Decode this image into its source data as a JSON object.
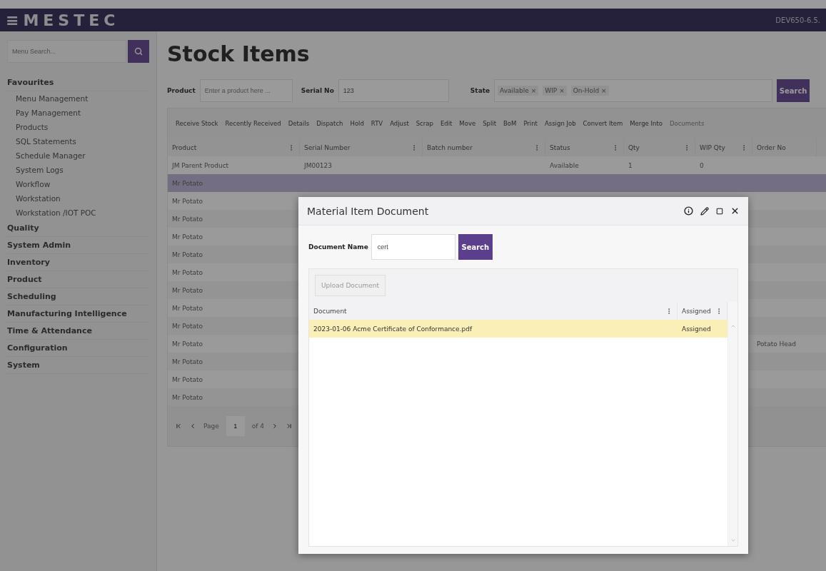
{
  "header": {
    "logo": "≡MESTEC",
    "version": "DEV650-6.5."
  },
  "sidebar": {
    "search": {
      "placeholder": "Menu Search..."
    },
    "groups": [
      {
        "label": "Favourites",
        "children": [
          {
            "label": "Menu Management"
          },
          {
            "label": "Pay Management"
          },
          {
            "label": "Products"
          },
          {
            "label": "SQL Statements"
          },
          {
            "label": "Schedule Manager"
          },
          {
            "label": "System Logs"
          },
          {
            "label": "Workflow"
          },
          {
            "label": "Workstation"
          },
          {
            "label": "Workstation /IOT POC"
          }
        ]
      },
      {
        "label": "Quality"
      },
      {
        "label": "System Admin"
      },
      {
        "label": "Inventory"
      },
      {
        "label": "Product"
      },
      {
        "label": "Scheduling"
      },
      {
        "label": "Manufacturing Intelligence"
      },
      {
        "label": "Time & Attendance"
      },
      {
        "label": "Configuration"
      },
      {
        "label": "System"
      }
    ]
  },
  "page": {
    "title": "Stock Items"
  },
  "filters": {
    "product": {
      "label": "Product",
      "placeholder": "Enter a product here ..."
    },
    "serial": {
      "label": "Serial No",
      "value": "123"
    },
    "state": {
      "label": "State",
      "chips": [
        "Available",
        "WIP",
        "On-Hold"
      ],
      "remove": "×"
    },
    "search_button": "Search"
  },
  "toolbar": [
    {
      "label": "Receive Stock",
      "disabled": false
    },
    {
      "label": "Recently Received",
      "disabled": false
    },
    {
      "label": "Details",
      "disabled": false
    },
    {
      "label": "Dispatch",
      "disabled": false
    },
    {
      "label": "Hold",
      "disabled": false
    },
    {
      "label": "RTV",
      "disabled": false
    },
    {
      "label": "Adjust",
      "disabled": false
    },
    {
      "label": "Scrap",
      "disabled": false
    },
    {
      "label": "Edit",
      "disabled": false
    },
    {
      "label": "Move",
      "disabled": false
    },
    {
      "label": "Split",
      "disabled": false
    },
    {
      "label": "BoM",
      "disabled": false
    },
    {
      "label": "Print",
      "disabled": false
    },
    {
      "label": "Assign Job",
      "disabled": false
    },
    {
      "label": "Convert Item",
      "disabled": false
    },
    {
      "label": "Merge Into",
      "disabled": false
    },
    {
      "label": "Documents",
      "disabled": true
    }
  ],
  "table": {
    "columns": [
      "Product",
      "Serial Number",
      "Batch number",
      "Status",
      "Qty",
      "WIP Qty",
      "Order No"
    ],
    "rows": [
      {
        "selected": false,
        "cells": [
          "JM Parent Product",
          "JM00123",
          "",
          "Available",
          "1",
          "0",
          ""
        ]
      },
      {
        "selected": true,
        "cells": [
          "Mr Potato",
          "",
          "",
          "",
          "",
          "",
          ""
        ]
      },
      {
        "selected": false,
        "cells": [
          "Mr Potato",
          "",
          "",
          "",
          "",
          "",
          ""
        ]
      },
      {
        "selected": false,
        "cells": [
          "Mr Potato",
          "",
          "",
          "",
          "",
          "",
          ""
        ]
      },
      {
        "selected": false,
        "cells": [
          "Mr Potato",
          "",
          "",
          "",
          "",
          "",
          ""
        ]
      },
      {
        "selected": false,
        "cells": [
          "Mr Potato",
          "",
          "",
          "",
          "",
          "",
          ""
        ]
      },
      {
        "selected": false,
        "cells": [
          "Mr Potato",
          "",
          "",
          "",
          "",
          "",
          ""
        ]
      },
      {
        "selected": false,
        "cells": [
          "Mr Potato",
          "",
          "",
          "",
          "",
          "",
          ""
        ]
      },
      {
        "selected": false,
        "cells": [
          "Mr Potato",
          "",
          "",
          "",
          "",
          "",
          ""
        ]
      },
      {
        "selected": false,
        "cells": [
          "Mr Potato",
          "",
          "",
          "",
          "",
          "",
          ""
        ]
      },
      {
        "selected": false,
        "cells": [
          "Mr Potato",
          "",
          "",
          "",
          "",
          "",
          "Potato Head"
        ]
      },
      {
        "selected": false,
        "cells": [
          "Mr Potato",
          "",
          "",
          "",
          "",
          "",
          ""
        ]
      },
      {
        "selected": false,
        "cells": [
          "Mr Potato",
          "",
          "",
          "",
          "",
          "",
          ""
        ]
      },
      {
        "selected": false,
        "cells": [
          "Mr Potato",
          "",
          "",
          "",
          "",
          "",
          ""
        ]
      }
    ]
  },
  "pager": {
    "label": "Page",
    "page": "1",
    "of": "of 4"
  },
  "dialog": {
    "title": "Material Item Document",
    "field": {
      "label": "Document Name",
      "value": "cert"
    },
    "search_button": "Search",
    "upload": {
      "label": "Upload Document",
      "disabled": true
    },
    "columns": [
      "Document",
      "Assigned"
    ],
    "rows": [
      {
        "selected": true,
        "cells": [
          "2023-01-06 Acme Certificate of Conformance.pdf",
          "Assigned"
        ]
      }
    ]
  }
}
